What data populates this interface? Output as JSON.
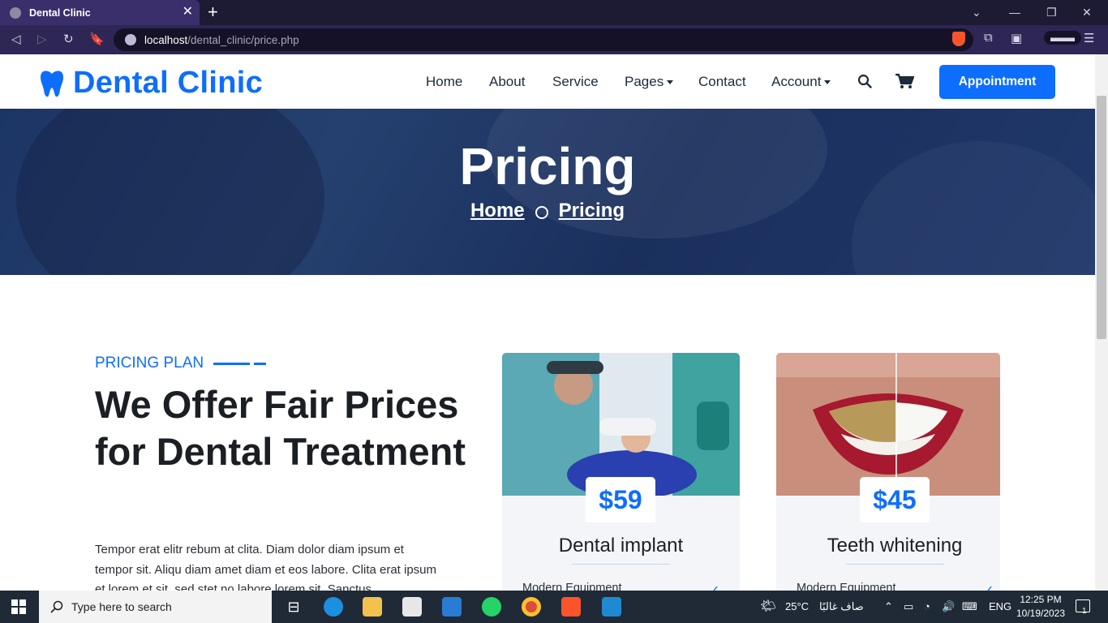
{
  "browser": {
    "tab_title": "Dental Clinic",
    "url_host": "localhost",
    "url_path": "/dental_clinic/price.php"
  },
  "site": {
    "logo_text": "Dental Clinic",
    "nav": {
      "home": "Home",
      "about": "About",
      "service": "Service",
      "pages": "Pages",
      "contact": "Contact",
      "account": "Account"
    },
    "appointment_button": "Appointment"
  },
  "hero": {
    "title": "Pricing",
    "breadcrumb_home": "Home",
    "breadcrumb_current": "Pricing"
  },
  "pricing_section": {
    "eyebrow": "PRICING PLAN",
    "heading": "We Offer Fair Prices for Dental Treatment",
    "body": "Tempor erat elitr rebum at clita. Diam dolor diam ipsum et tempor sit. Aliqu diam amet diam et eos labore. Clita erat ipsum et lorem et sit, sed stet no labore lorem sit. Sanctus"
  },
  "cards": [
    {
      "price": "$59",
      "name": "Dental implant",
      "feature": "Modern Equipment"
    },
    {
      "price": "$45",
      "name": "Teeth whitening",
      "feature": "Modern Equipment"
    }
  ],
  "taskbar": {
    "search_placeholder": "Type here to search",
    "temperature": "25°C",
    "weather": "صاف غالبًا",
    "language": "ENG",
    "time": "12:25 PM",
    "date": "10/19/2023",
    "notification_count": "1"
  },
  "colors": {
    "brand": "#0d6efd",
    "heading": "#1b1f24",
    "hero_overlay": "#1c3565"
  }
}
